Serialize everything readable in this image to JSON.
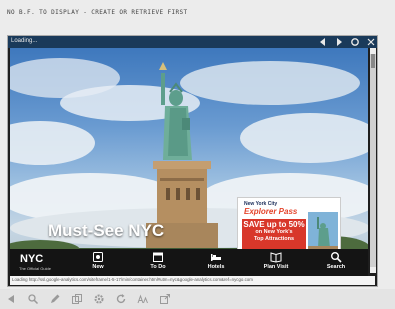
{
  "message": "NO B.F. TO DISPLAY - CREATE OR RETRIEVE FIRST",
  "browser": {
    "title": "Loading...",
    "icons": [
      "back-icon",
      "forward-icon",
      "refresh-icon",
      "close-icon"
    ]
  },
  "page": {
    "hero_title": "Must-See NYC",
    "ad": {
      "small": "New York City",
      "brand": "Explorer Pass",
      "save": "SAVE up to 50%",
      "line1": "on New York's",
      "line2": "Top Attractions"
    },
    "nav": {
      "logo": "NYC",
      "logo_sub": "The Official Guide",
      "items": [
        {
          "label": "New",
          "icon": "new-icon"
        },
        {
          "label": "To Do",
          "icon": "todo-icon"
        },
        {
          "label": "Hotels",
          "icon": "bed-icon"
        },
        {
          "label": "Plan Visit",
          "icon": "book-icon"
        },
        {
          "label": "Search",
          "icon": "search-icon"
        }
      ]
    }
  },
  "status": "Loading http://ssl.google-analytics.com/siteframe/1-5-17/min/container.html#utm=nyc&google-analytics.com&ref=nycgo.com",
  "toolbar": {
    "icons": [
      "back-arrow-icon",
      "search-icon",
      "pen-icon",
      "copy-icon",
      "settings-icon",
      "refresh-icon",
      "text-size-icon",
      "open-external-icon"
    ]
  },
  "colors": {
    "titlebar": "#1a3a5a",
    "ad_red": "#d8372a",
    "navbar": "#141414"
  }
}
